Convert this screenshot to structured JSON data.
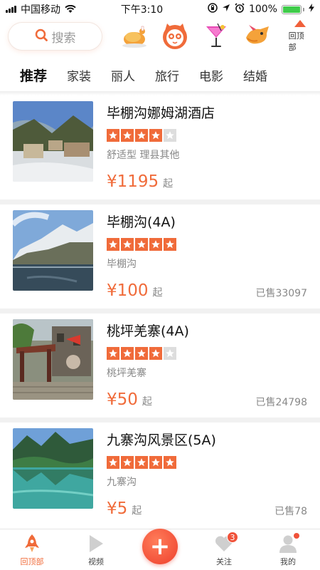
{
  "status_bar": {
    "carrier": "中国移动",
    "time": "下午3:10",
    "battery": "100%"
  },
  "header": {
    "search_placeholder": "搜索",
    "back_to_top": "回顶部",
    "icons": [
      "roast-chicken-icon",
      "cat-mascot-icon",
      "cocktail-icon",
      "dog-mascot-icon"
    ]
  },
  "tabs": [
    "推荐",
    "家装",
    "丽人",
    "旅行",
    "电影",
    "结婚"
  ],
  "items": [
    {
      "title": "毕棚沟娜姆湖酒店",
      "stars": 4,
      "desc": "舒适型  理县其他",
      "price": "¥1195",
      "unit": "起",
      "sold": ""
    },
    {
      "title": "毕棚沟(4A)",
      "stars": 5,
      "desc": "毕棚沟",
      "price": "¥100",
      "unit": "起",
      "sold": "已售33097"
    },
    {
      "title": "桃坪羌寨(4A)",
      "stars": 4,
      "desc": "桃坪羌寨",
      "price": "¥50",
      "unit": "起",
      "sold": "已售24798"
    },
    {
      "title": "九寨沟风景区(5A)",
      "stars": 5,
      "desc": "九寨沟",
      "price": "¥5",
      "unit": "起",
      "sold": "已售78"
    }
  ],
  "bottom_nav": {
    "home": "回顶部",
    "video": "视频",
    "add": "+",
    "follow": "关注",
    "follow_badge": "3",
    "mine": "我的"
  },
  "colors": {
    "accent": "#f06b3a",
    "star_empty": "#dddddd",
    "divider": "#f1f1f1"
  }
}
